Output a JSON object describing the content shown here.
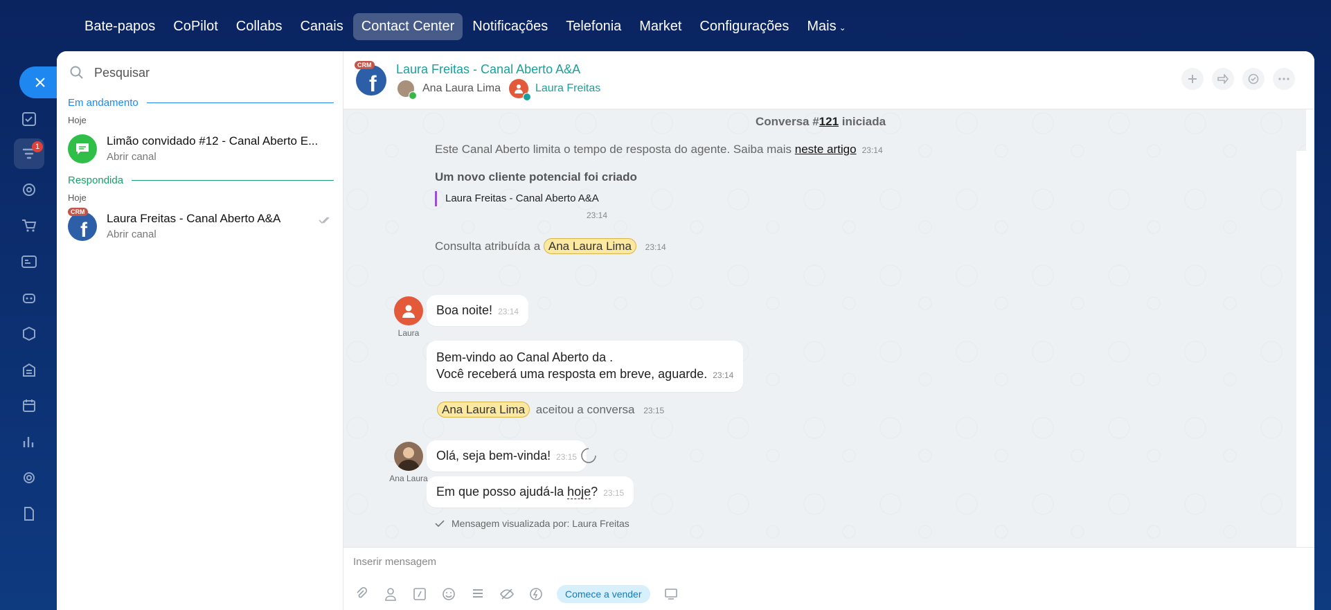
{
  "nav": {
    "items": [
      "Bate-papos",
      "CoPilot",
      "Collabs",
      "Canais",
      "Contact Center",
      "Notificações",
      "Telefonia",
      "Market",
      "Configurações",
      "Mais"
    ],
    "active": "Contact Center"
  },
  "rail": {
    "badge_count": "1"
  },
  "sidebar": {
    "search_placeholder": "Pesquisar",
    "sections": [
      {
        "title": "Em andamento",
        "day": "Hoje",
        "items": [
          {
            "title": "Limão convidado #12 - Canal Aberto E...",
            "subtitle": "Abrir canal"
          }
        ]
      },
      {
        "title": "Respondida",
        "day": "Hoje",
        "items": [
          {
            "title": "Laura Freitas - Canal Aberto A&A",
            "subtitle": "Abrir canal",
            "crm": "CRM"
          }
        ]
      }
    ]
  },
  "header": {
    "crm": "CRM",
    "title": "Laura Freitas - Canal Aberto A&A",
    "agent": "Ana Laura Lima",
    "client": "Laura Freitas"
  },
  "chat": {
    "started_prefix": "Conversa #",
    "started_number": "121",
    "started_suffix": " iniciada",
    "limit_text": "Este Canal Aberto limita o tempo de resposta do agente. Saiba mais ",
    "limit_link": "neste artigo",
    "limit_time": "23:14",
    "lead_title": "Um novo cliente potencial foi criado",
    "lead_name": "Laura Freitas - Canal Aberto A&A",
    "lead_time": "23:14",
    "assigned_text": "Consulta atribuída a",
    "assigned_name": "Ana Laura Lima",
    "assigned_time": "23:14",
    "msg1": {
      "text": "Boa noite!",
      "time": "23:14",
      "author": "Laura"
    },
    "msg2": {
      "line1": "Bem-vindo ao Canal Aberto da .",
      "line2": "Você receberá uma resposta em breve, aguarde.",
      "time": "23:14"
    },
    "accepted_name": "Ana Laura Lima",
    "accepted_text": "aceitou a conversa",
    "accepted_time": "23:15",
    "msg3": {
      "text": "Olá, seja bem-vinda!",
      "time": "23:15",
      "author": "Ana Laura"
    },
    "msg4": {
      "text_pre": "Em que posso ajudá-la ",
      "text_link": "hoje",
      "text_post": "?",
      "time": "23:15"
    },
    "seen": "Mensagem visualizada por: Laura Freitas"
  },
  "composer": {
    "placeholder": "Inserir mensagem",
    "sell_label": "Comece a vender"
  },
  "colors": {
    "accent": "#1aa09a",
    "brand": "#1e88f0",
    "nav_bg": "#0a2460"
  }
}
